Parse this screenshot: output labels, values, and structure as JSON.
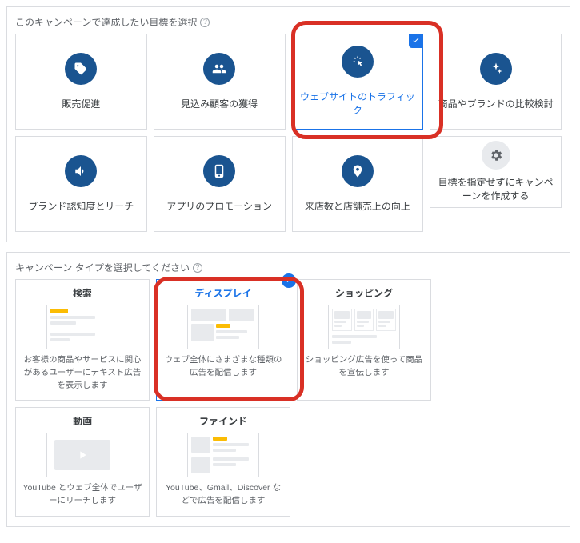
{
  "section1": {
    "heading": "このキャンペーンで達成したい目標を選択",
    "goals": [
      {
        "id": "sales",
        "label": "販売促進",
        "icon": "tag"
      },
      {
        "id": "leads",
        "label": "見込み顧客の獲得",
        "icon": "people"
      },
      {
        "id": "traffic",
        "label": "ウェブサイトのトラフィック",
        "icon": "click",
        "selected": true
      },
      {
        "id": "consideration",
        "label": "商品やブランドの比較検討",
        "icon": "sparkle"
      },
      {
        "id": "awareness",
        "label": "ブランド認知度とリーチ",
        "icon": "megaphone"
      },
      {
        "id": "app",
        "label": "アプリのプロモーション",
        "icon": "phone"
      },
      {
        "id": "store",
        "label": "来店数と店舗売上の向上",
        "icon": "pin"
      },
      {
        "id": "nogoal",
        "label": "目標を指定せずにキャンペーンを作成する",
        "icon": "gear",
        "nogoal": true
      }
    ]
  },
  "section2": {
    "heading": "キャンペーン タイプを選択してください",
    "types": [
      {
        "id": "search",
        "title": "検索",
        "desc": "お客様の商品やサービスに関心があるユーザーにテキスト広告を表示します"
      },
      {
        "id": "display",
        "title": "ディスプレイ",
        "desc": "ウェブ全体にさまざまな種類の広告を配信します",
        "selected": true
      },
      {
        "id": "shopping",
        "title": "ショッピング",
        "desc": "ショッピング広告を使って商品を宣伝します"
      },
      {
        "id": "video",
        "title": "動画",
        "desc": "YouTube とウェブ全体でユーザーにリーチします"
      },
      {
        "id": "discovery",
        "title": "ファインド",
        "desc": "YouTube、Gmail、Discover などで広告を配信します"
      }
    ]
  }
}
